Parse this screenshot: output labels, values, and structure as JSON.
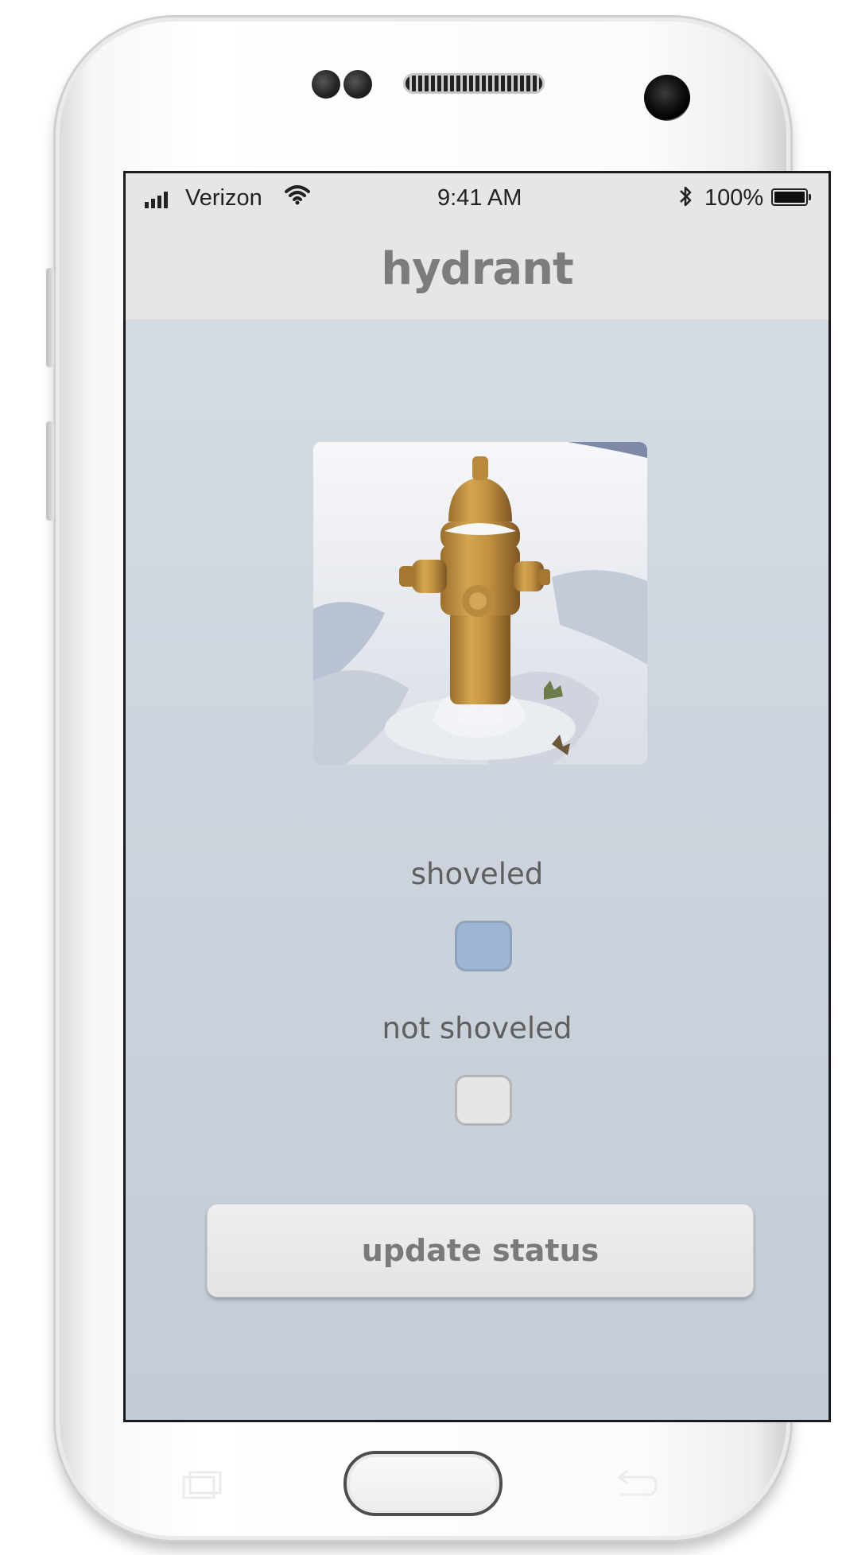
{
  "statusbar": {
    "carrier": "Verizon",
    "time": "9:41 AM",
    "battery": "100%",
    "icons": [
      "signal-icon",
      "wifi-icon",
      "bluetooth-icon",
      "battery-icon"
    ]
  },
  "header": {
    "title": "hydrant"
  },
  "photo": {
    "icon": "fire-hydrant-in-snow-image"
  },
  "status_options": [
    {
      "label": "shoveled",
      "checked": true
    },
    {
      "label": "not shoveled",
      "checked": false
    }
  ],
  "actions": {
    "update_label": "update status"
  },
  "colors": {
    "screen_bg": "#cdd4dd",
    "bar_bg": "#e6e6e6",
    "checkbox_checked": "#9cb6d3",
    "checkbox_unchecked": "#e6e6e6",
    "title_text": "#7c7c7c"
  }
}
